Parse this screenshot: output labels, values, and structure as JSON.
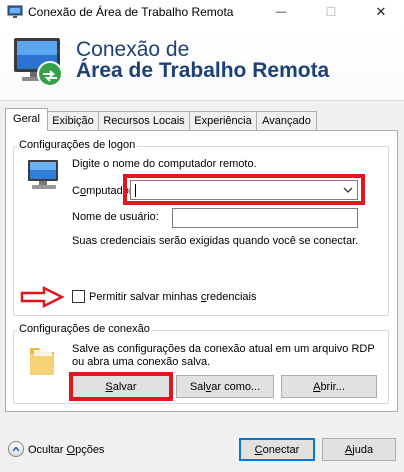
{
  "window": {
    "title": "Conexão de Área de Trabalho Remota",
    "controls": {
      "minimize": "—",
      "maximize": "☐",
      "close": "✕"
    }
  },
  "banner": {
    "line1": "Conexão de",
    "line2": "Área de Trabalho Remota",
    "icon": "remote-desktop-icon"
  },
  "tabs": [
    {
      "label": "Geral",
      "active": true
    },
    {
      "label": "Exibição",
      "active": false
    },
    {
      "label": "Recursos Locais",
      "active": false
    },
    {
      "label": "Experiência",
      "active": false
    },
    {
      "label": "Avançado",
      "active": false
    }
  ],
  "logon": {
    "group_title": "Configurações de logon",
    "instruction": "Digite o nome do computador remoto.",
    "computer_label_pre": "C",
    "computer_label_u": "o",
    "computer_label_post": "mputador:",
    "computer_value": "",
    "username_label": "Nome de usuário:",
    "username_value": "",
    "credentials_note": "Suas credenciais serão exigidas quando você se conectar.",
    "allow_save_pre": "Permitir salvar minhas ",
    "allow_save_u": "c",
    "allow_save_post": "redenciais",
    "allow_save_checked": false
  },
  "connection": {
    "group_title": "Configurações de conexão",
    "description_line1": "Salve as configurações da conexão atual em um arquivo RDP",
    "description_line2": "ou abra uma conexão salva.",
    "save_u": "S",
    "save_rest": "alvar",
    "save_as_pre": "Sal",
    "save_as_u": "v",
    "save_as_post": "ar como...",
    "open_u": "A",
    "open_rest": "brir..."
  },
  "footer": {
    "hide_options_pre": "Ocultar ",
    "hide_options_u": "O",
    "hide_options_post": "pções",
    "connect_u": "C",
    "connect_rest": "onectar",
    "help_u": "A",
    "help_rest": "juda"
  },
  "colors": {
    "banner_text": "#1e3f78",
    "highlight_annotation": "#e4161d",
    "default_button_border": "#0078d7"
  }
}
